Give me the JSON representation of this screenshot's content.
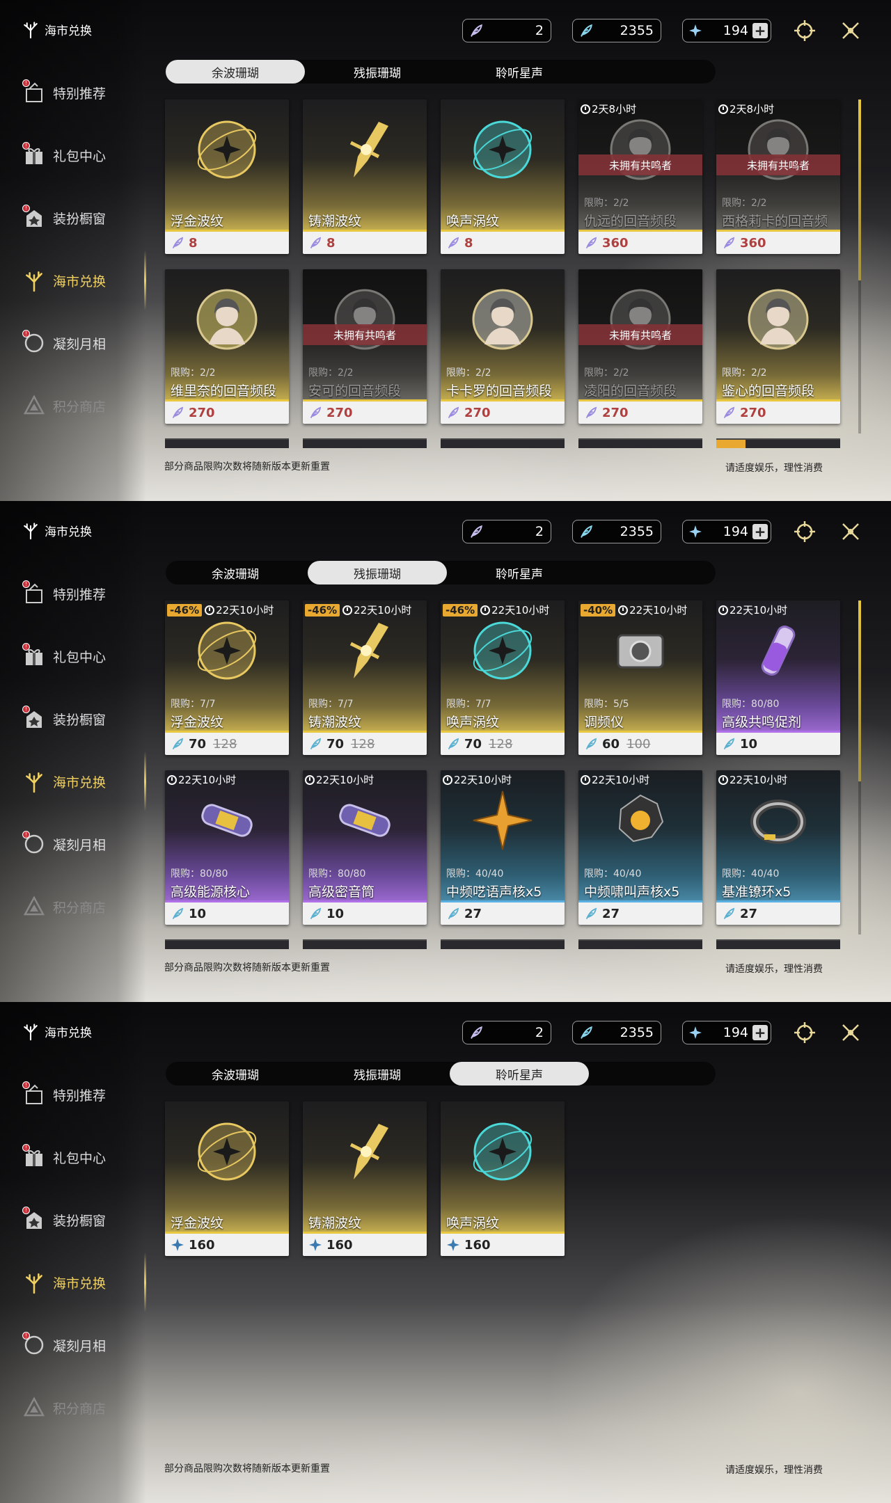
{
  "brand": "海市兑换",
  "nav": [
    {
      "label": "特别推荐",
      "icon": "featured-icon"
    },
    {
      "label": "礼包中心",
      "icon": "gift-icon"
    },
    {
      "label": "装扮橱窗",
      "icon": "wardrobe-icon"
    },
    {
      "label": "海市兑换",
      "icon": "coral-exchange-icon"
    },
    {
      "label": "凝刻月相",
      "icon": "moon-icon"
    },
    {
      "label": "积分商店",
      "icon": "points-shop-icon"
    }
  ],
  "currency": {
    "c1": "2",
    "c2": "2355",
    "c3": "194"
  },
  "tabs": [
    "余波珊瑚",
    "残振珊瑚",
    "聆听星声"
  ],
  "notice_left": "部分商品限购次数将随新版本更新重置",
  "notice_right": "请适度娱乐，理性消费",
  "owned_text": "未拥有共鸣者",
  "panel1": {
    "row1": [
      {
        "name": "浮金波纹",
        "price": "8"
      },
      {
        "name": "铸潮波纹",
        "price": "8"
      },
      {
        "name": "唤声涡纹",
        "price": "8"
      },
      {
        "name": "仇远的回音频段",
        "price": "360",
        "timer": "2天8小时",
        "limit": "限购：2/2"
      },
      {
        "name": "西格莉卡的回音频段",
        "price": "360",
        "timer": "2天8小时",
        "limit": "限购：2/2"
      }
    ],
    "row2": [
      {
        "name": "维里奈的回音频段",
        "price": "270",
        "limit": "限购：2/2"
      },
      {
        "name": "安可的回音频段",
        "price": "270",
        "limit": "限购：2/2"
      },
      {
        "name": "卡卡罗的回音频段",
        "price": "270",
        "limit": "限购：2/2"
      },
      {
        "name": "凌阳的回音频段",
        "price": "270",
        "limit": "限购：2/2"
      },
      {
        "name": "鉴心的回音频段",
        "price": "270",
        "limit": "限购：2/2"
      }
    ]
  },
  "panel2": {
    "row1": [
      {
        "name": "浮金波纹",
        "price": "70",
        "old": "128",
        "disc": "-46%",
        "timer": "22天10小时",
        "limit": "限购：7/7"
      },
      {
        "name": "铸潮波纹",
        "price": "70",
        "old": "128",
        "disc": "-46%",
        "timer": "22天10小时",
        "limit": "限购：7/7"
      },
      {
        "name": "唤声涡纹",
        "price": "70",
        "old": "128",
        "disc": "-46%",
        "timer": "22天10小时",
        "limit": "限购：7/7"
      },
      {
        "name": "调频仪",
        "price": "60",
        "old": "100",
        "disc": "-40%",
        "timer": "22天10小时",
        "limit": "限购：5/5"
      },
      {
        "name": "高级共鸣促剂",
        "price": "10",
        "timer": "22天10小时",
        "limit": "限购：80/80"
      }
    ],
    "row2": [
      {
        "name": "高级能源核心",
        "price": "10",
        "timer": "22天10小时",
        "limit": "限购：80/80"
      },
      {
        "name": "高级密音筒",
        "price": "10",
        "timer": "22天10小时",
        "limit": "限购：80/80"
      },
      {
        "name": "中频呓语声核x5",
        "price": "27",
        "timer": "22天10小时",
        "limit": "限购：40/40"
      },
      {
        "name": "中频啸叫声核x5",
        "price": "27",
        "timer": "22天10小时",
        "limit": "限购：40/40"
      },
      {
        "name": "基准镣环x5",
        "price": "27",
        "timer": "22天10小时",
        "limit": "限购：40/40"
      }
    ]
  },
  "panel3": {
    "row1": [
      {
        "name": "浮金波纹",
        "price": "160"
      },
      {
        "name": "铸潮波纹",
        "price": "160"
      },
      {
        "name": "唤声涡纹",
        "price": "160"
      }
    ]
  }
}
